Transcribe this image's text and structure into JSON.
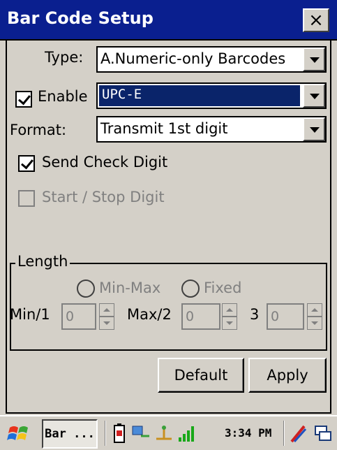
{
  "window": {
    "title": "Bar Code Setup",
    "close_label": "×"
  },
  "form": {
    "type_label": "Type:",
    "type_value": "A.Numeric-only Barcodes",
    "enable_label": "Enable",
    "enable_checked": true,
    "symbology_value": "UPC-E",
    "format_label": "Format:",
    "format_value": "Transmit 1st digit",
    "send_check_digit_label": "Send Check Digit",
    "send_check_digit_checked": true,
    "start_stop_label": "Start / Stop Digit",
    "start_stop_checked": false
  },
  "length": {
    "group_label": "Length",
    "radio_minmax_label": "Min-Max",
    "radio_fixed_label": "Fixed",
    "min_label": "Min/1",
    "min_value": "0",
    "max_label": "Max/2",
    "max_value": "0",
    "third_label": "3",
    "third_value": "0"
  },
  "buttons": {
    "default_label": "Default",
    "apply_label": "Apply"
  },
  "taskbar": {
    "task_label": "Bar ...",
    "clock": "3:34 PM"
  },
  "colors": {
    "title_bg": "#0a1f8f",
    "selection_bg": "#0a246a",
    "face": "#d4d0c8"
  }
}
